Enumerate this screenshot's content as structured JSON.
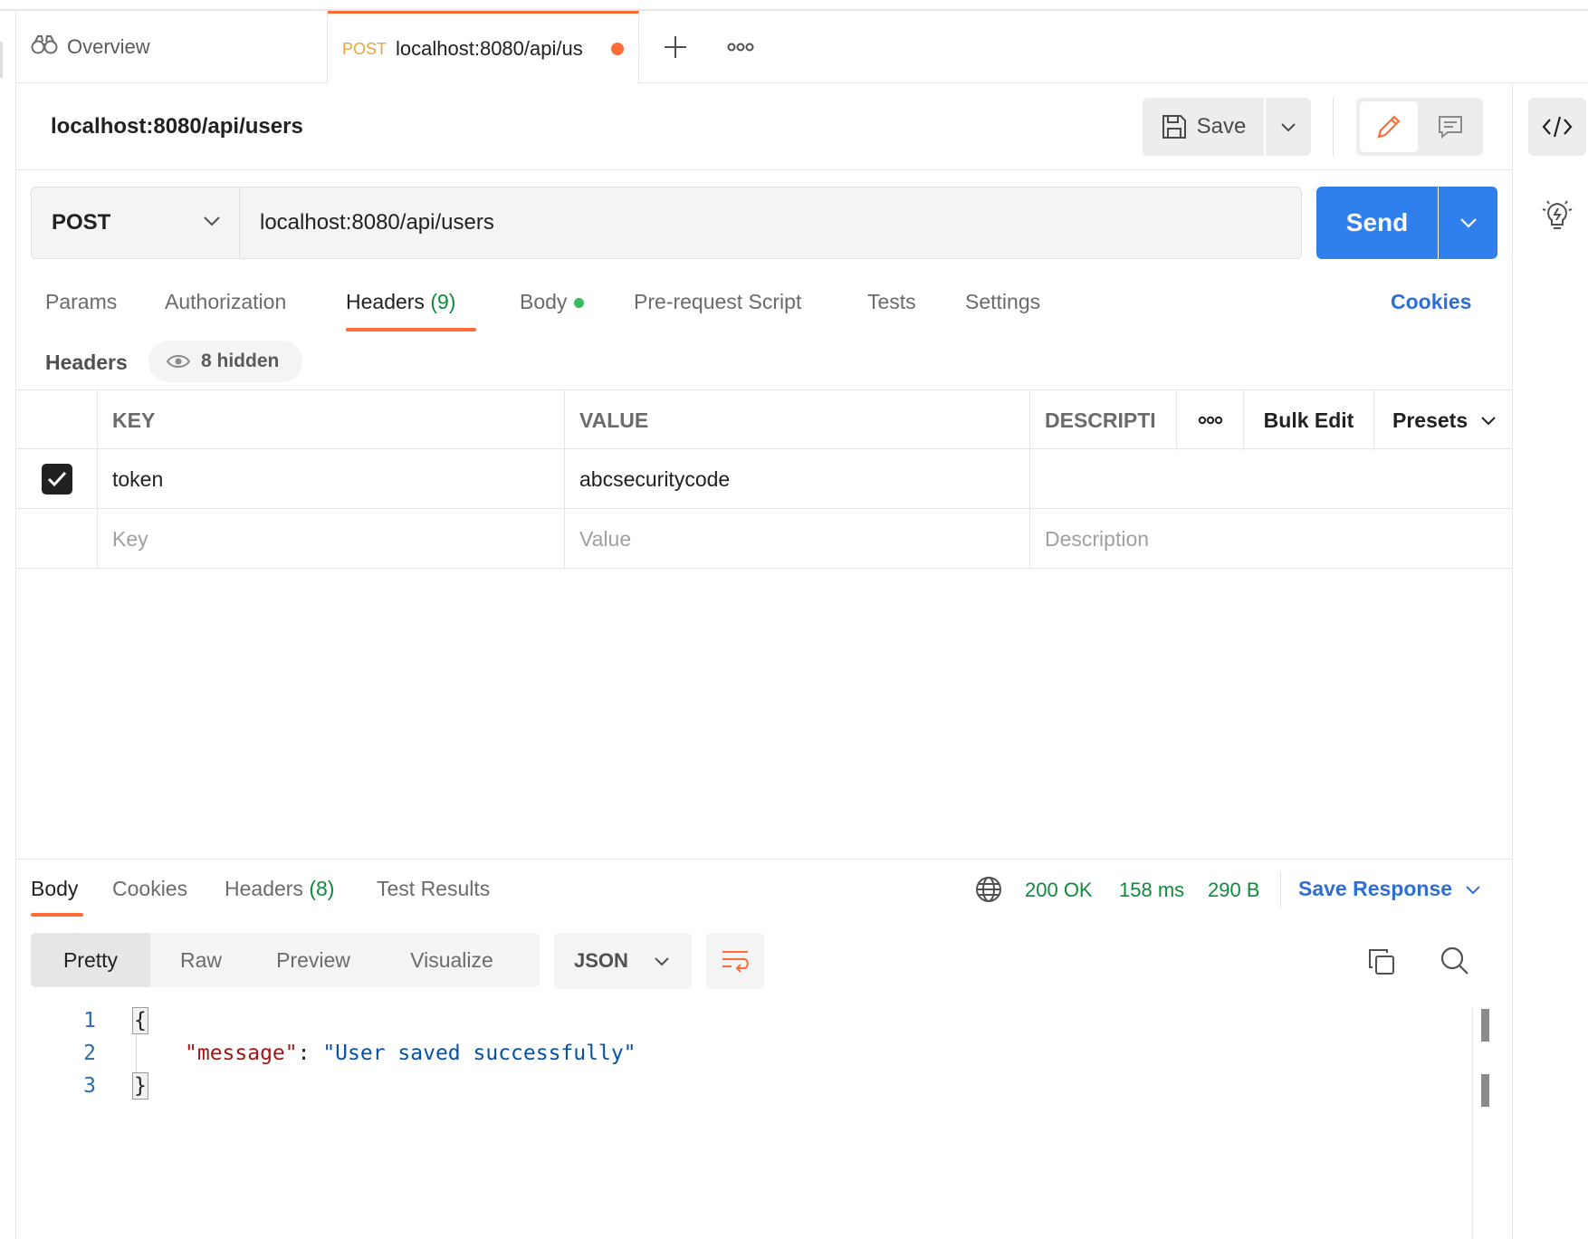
{
  "tabs": {
    "overview_label": "Overview",
    "active": {
      "method": "POST",
      "url": "localhost:8080/api/us"
    }
  },
  "request": {
    "name": "localhost:8080/api/users",
    "save_label": "Save",
    "method": "POST",
    "url": "localhost:8080/api/users",
    "send_label": "Send"
  },
  "request_tabs": {
    "params": "Params",
    "authorization": "Authorization",
    "headers": "Headers",
    "headers_count": "(9)",
    "body": "Body",
    "prerequest": "Pre-request Script",
    "tests": "Tests",
    "settings": "Settings",
    "cookies": "Cookies"
  },
  "headers_section": {
    "label": "Headers",
    "hidden_label": "8 hidden",
    "columns": {
      "key": "KEY",
      "value": "VALUE",
      "description": "DESCRIPTI",
      "bulk_edit": "Bulk Edit",
      "presets": "Presets"
    },
    "rows": [
      {
        "checked": true,
        "key": "token",
        "value": "abcsecuritycode",
        "description": ""
      }
    ],
    "placeholders": {
      "key": "Key",
      "value": "Value",
      "description": "Description"
    }
  },
  "response": {
    "tabs": {
      "body": "Body",
      "cookies": "Cookies",
      "headers": "Headers",
      "headers_count": "(8)",
      "test_results": "Test Results"
    },
    "status": "200 OK",
    "time": "158 ms",
    "size": "290 B",
    "save_response": "Save Response",
    "views": {
      "pretty": "Pretty",
      "raw": "Raw",
      "preview": "Preview",
      "visualize": "Visualize"
    },
    "format": "JSON",
    "code": {
      "line_numbers": [
        "1",
        "2",
        "3"
      ],
      "open_brace": "{",
      "key": "\"message\"",
      "colon": ": ",
      "value": "\"User saved successfully\"",
      "close_brace": "}"
    }
  },
  "colors": {
    "accent": "#ff6c37",
    "send": "#2f80ed",
    "link": "#2f6fd3",
    "success": "#0f8a3c"
  }
}
